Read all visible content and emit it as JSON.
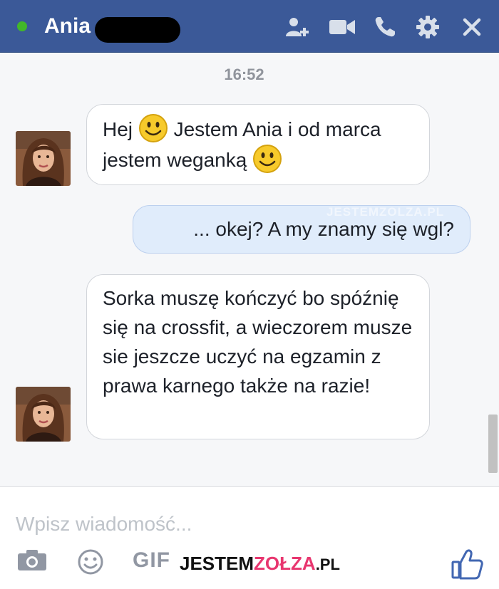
{
  "header": {
    "contact_name": "Ania",
    "status": "online",
    "online_color": "#42b72a",
    "bar_color": "#3b5998",
    "icons": [
      "add-friend-icon",
      "video-call-icon",
      "phone-icon",
      "gear-icon",
      "close-icon"
    ]
  },
  "conversation": {
    "timestamp": "16:52",
    "messages": [
      {
        "from": "Ania",
        "parts": [
          "Hej ",
          " Jestem Ania i od marca jestem weganką "
        ],
        "emoji": [
          "smiley",
          "smiley"
        ]
      },
      {
        "from": "me",
        "parts": [
          "... okej? A my znamy się wgl?"
        ]
      },
      {
        "from": "Ania",
        "parts": [
          "Sorka muszę kończyć bo spóźnię się na crossfit, a wieczorem musze sie jeszcze uczyć na egzamin z prawa karnego także na razie!"
        ]
      }
    ],
    "watermark": "JESTEMZOLZA.PL"
  },
  "composer": {
    "placeholder": "Wpisz wiadomość...",
    "gif_label": "GIF",
    "icons": [
      "camera-icon",
      "emoji-icon",
      "gif-icon",
      "like-icon"
    ]
  },
  "brand": {
    "part1": "JESTEM",
    "part2": "ZOŁZA",
    "part3": ".PL"
  }
}
